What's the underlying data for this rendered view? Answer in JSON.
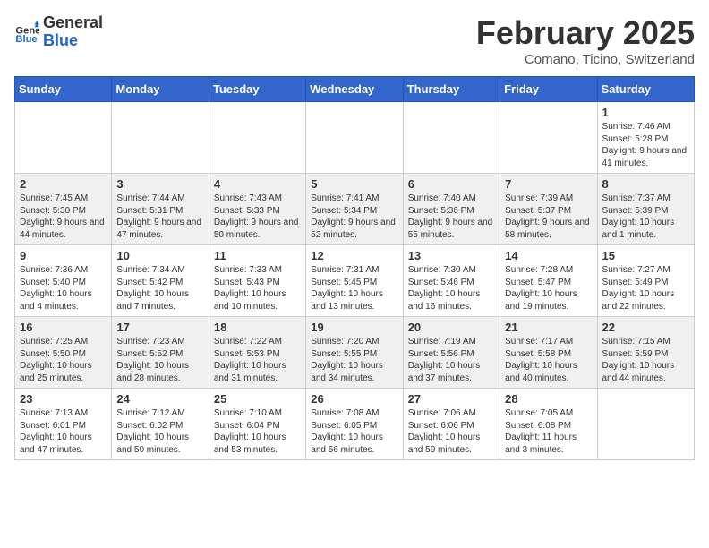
{
  "header": {
    "logo_general": "General",
    "logo_blue": "Blue",
    "title": "February 2025",
    "subtitle": "Comano, Ticino, Switzerland"
  },
  "weekdays": [
    "Sunday",
    "Monday",
    "Tuesday",
    "Wednesday",
    "Thursday",
    "Friday",
    "Saturday"
  ],
  "weeks": [
    [
      {
        "day": "",
        "info": ""
      },
      {
        "day": "",
        "info": ""
      },
      {
        "day": "",
        "info": ""
      },
      {
        "day": "",
        "info": ""
      },
      {
        "day": "",
        "info": ""
      },
      {
        "day": "",
        "info": ""
      },
      {
        "day": "1",
        "info": "Sunrise: 7:46 AM\nSunset: 5:28 PM\nDaylight: 9 hours and 41 minutes."
      }
    ],
    [
      {
        "day": "2",
        "info": "Sunrise: 7:45 AM\nSunset: 5:30 PM\nDaylight: 9 hours and 44 minutes."
      },
      {
        "day": "3",
        "info": "Sunrise: 7:44 AM\nSunset: 5:31 PM\nDaylight: 9 hours and 47 minutes."
      },
      {
        "day": "4",
        "info": "Sunrise: 7:43 AM\nSunset: 5:33 PM\nDaylight: 9 hours and 50 minutes."
      },
      {
        "day": "5",
        "info": "Sunrise: 7:41 AM\nSunset: 5:34 PM\nDaylight: 9 hours and 52 minutes."
      },
      {
        "day": "6",
        "info": "Sunrise: 7:40 AM\nSunset: 5:36 PM\nDaylight: 9 hours and 55 minutes."
      },
      {
        "day": "7",
        "info": "Sunrise: 7:39 AM\nSunset: 5:37 PM\nDaylight: 9 hours and 58 minutes."
      },
      {
        "day": "8",
        "info": "Sunrise: 7:37 AM\nSunset: 5:39 PM\nDaylight: 10 hours and 1 minute."
      }
    ],
    [
      {
        "day": "9",
        "info": "Sunrise: 7:36 AM\nSunset: 5:40 PM\nDaylight: 10 hours and 4 minutes."
      },
      {
        "day": "10",
        "info": "Sunrise: 7:34 AM\nSunset: 5:42 PM\nDaylight: 10 hours and 7 minutes."
      },
      {
        "day": "11",
        "info": "Sunrise: 7:33 AM\nSunset: 5:43 PM\nDaylight: 10 hours and 10 minutes."
      },
      {
        "day": "12",
        "info": "Sunrise: 7:31 AM\nSunset: 5:45 PM\nDaylight: 10 hours and 13 minutes."
      },
      {
        "day": "13",
        "info": "Sunrise: 7:30 AM\nSunset: 5:46 PM\nDaylight: 10 hours and 16 minutes."
      },
      {
        "day": "14",
        "info": "Sunrise: 7:28 AM\nSunset: 5:47 PM\nDaylight: 10 hours and 19 minutes."
      },
      {
        "day": "15",
        "info": "Sunrise: 7:27 AM\nSunset: 5:49 PM\nDaylight: 10 hours and 22 minutes."
      }
    ],
    [
      {
        "day": "16",
        "info": "Sunrise: 7:25 AM\nSunset: 5:50 PM\nDaylight: 10 hours and 25 minutes."
      },
      {
        "day": "17",
        "info": "Sunrise: 7:23 AM\nSunset: 5:52 PM\nDaylight: 10 hours and 28 minutes."
      },
      {
        "day": "18",
        "info": "Sunrise: 7:22 AM\nSunset: 5:53 PM\nDaylight: 10 hours and 31 minutes."
      },
      {
        "day": "19",
        "info": "Sunrise: 7:20 AM\nSunset: 5:55 PM\nDaylight: 10 hours and 34 minutes."
      },
      {
        "day": "20",
        "info": "Sunrise: 7:19 AM\nSunset: 5:56 PM\nDaylight: 10 hours and 37 minutes."
      },
      {
        "day": "21",
        "info": "Sunrise: 7:17 AM\nSunset: 5:58 PM\nDaylight: 10 hours and 40 minutes."
      },
      {
        "day": "22",
        "info": "Sunrise: 7:15 AM\nSunset: 5:59 PM\nDaylight: 10 hours and 44 minutes."
      }
    ],
    [
      {
        "day": "23",
        "info": "Sunrise: 7:13 AM\nSunset: 6:01 PM\nDaylight: 10 hours and 47 minutes."
      },
      {
        "day": "24",
        "info": "Sunrise: 7:12 AM\nSunset: 6:02 PM\nDaylight: 10 hours and 50 minutes."
      },
      {
        "day": "25",
        "info": "Sunrise: 7:10 AM\nSunset: 6:04 PM\nDaylight: 10 hours and 53 minutes."
      },
      {
        "day": "26",
        "info": "Sunrise: 7:08 AM\nSunset: 6:05 PM\nDaylight: 10 hours and 56 minutes."
      },
      {
        "day": "27",
        "info": "Sunrise: 7:06 AM\nSunset: 6:06 PM\nDaylight: 10 hours and 59 minutes."
      },
      {
        "day": "28",
        "info": "Sunrise: 7:05 AM\nSunset: 6:08 PM\nDaylight: 11 hours and 3 minutes."
      },
      {
        "day": "",
        "info": ""
      }
    ]
  ]
}
